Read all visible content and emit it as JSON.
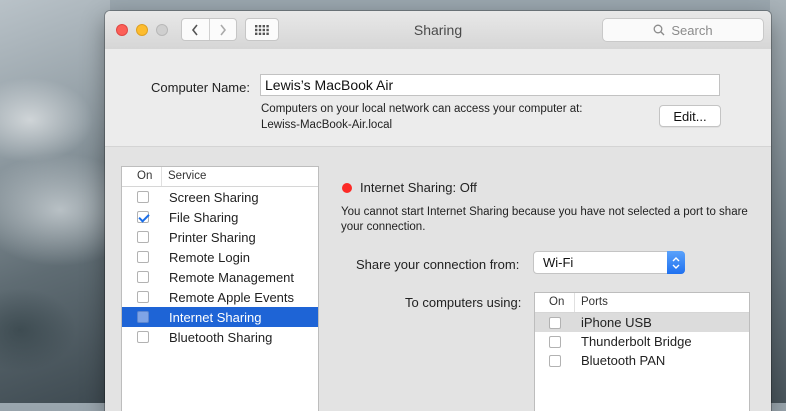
{
  "window": {
    "title": "Sharing",
    "search_placeholder": "Search"
  },
  "computer_name": {
    "label": "Computer Name:",
    "value": "Lewis’s MacBook Air",
    "info_line1": "Computers on your local network can access your computer at:",
    "info_line2": "Lewiss-MacBook-Air.local",
    "edit_button": "Edit..."
  },
  "services": {
    "col_on": "On",
    "col_service": "Service",
    "items": [
      {
        "name": "Screen Sharing",
        "checked": false,
        "selected": false
      },
      {
        "name": "File Sharing",
        "checked": true,
        "selected": false
      },
      {
        "name": "Printer Sharing",
        "checked": false,
        "selected": false
      },
      {
        "name": "Remote Login",
        "checked": false,
        "selected": false
      },
      {
        "name": "Remote Management",
        "checked": false,
        "selected": false
      },
      {
        "name": "Remote Apple Events",
        "checked": false,
        "selected": false
      },
      {
        "name": "Internet Sharing",
        "checked": false,
        "selected": true
      },
      {
        "name": "Bluetooth Sharing",
        "checked": false,
        "selected": false
      }
    ]
  },
  "detail": {
    "status": "Internet Sharing: Off",
    "status_color": "#fc2a26",
    "description": "You cannot start Internet Sharing because you have not selected a port to share your connection.",
    "share_from_label": "Share your connection from:",
    "share_from_value": "Wi-Fi",
    "to_computers_label": "To computers using:",
    "ports_col_on": "On",
    "ports_col_ports": "Ports",
    "ports": [
      {
        "name": "iPhone USB",
        "checked": false
      },
      {
        "name": "Thunderbolt Bridge",
        "checked": false
      },
      {
        "name": "Bluetooth PAN",
        "checked": false
      }
    ]
  },
  "colors": {
    "selection": "#1e64d6",
    "accent": "#1f71f0"
  }
}
